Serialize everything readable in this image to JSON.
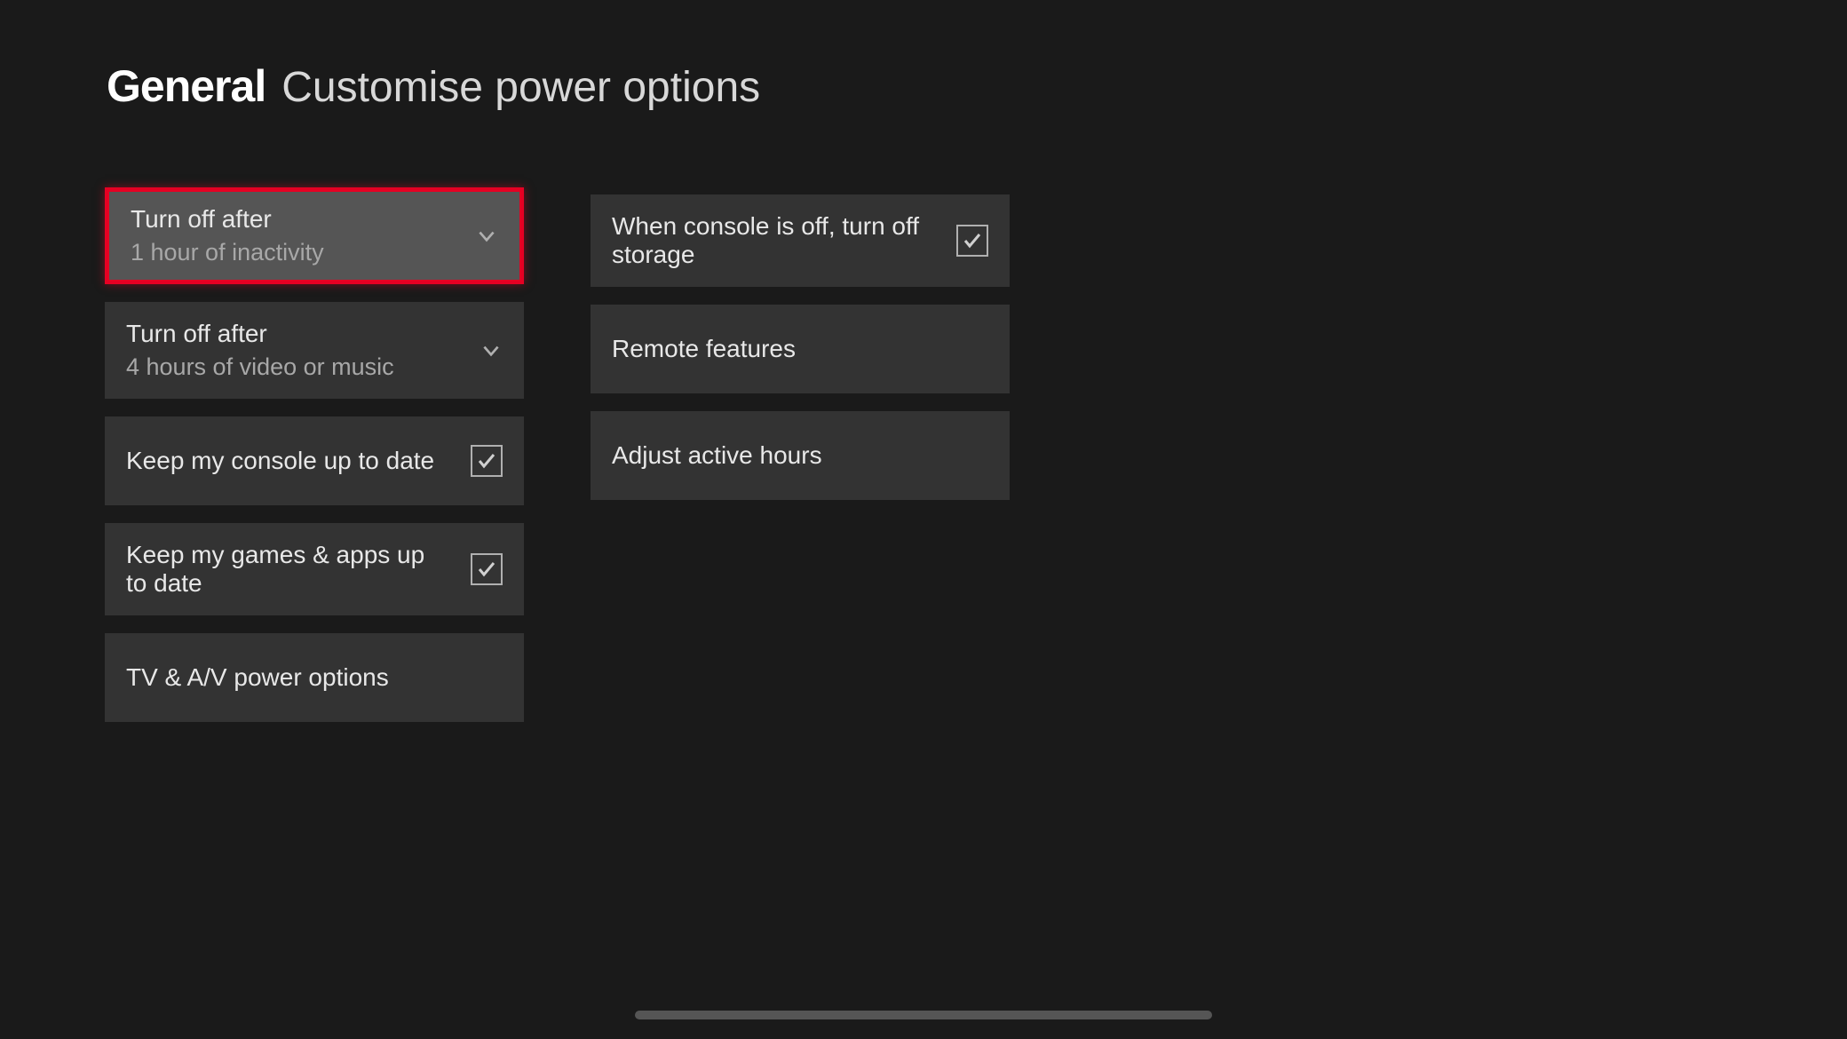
{
  "header": {
    "category": "General",
    "title": "Customise power options"
  },
  "left_column": {
    "turn_off_inactivity": {
      "label": "Turn off after",
      "value": "1 hour of inactivity"
    },
    "turn_off_media": {
      "label": "Turn off after",
      "value": "4 hours of video or music"
    },
    "keep_console_updated": {
      "label": "Keep my console up to date",
      "checked": true
    },
    "keep_games_updated": {
      "label": "Keep my games & apps up to date",
      "checked": true
    },
    "tv_av_power": {
      "label": "TV & A/V power options"
    }
  },
  "right_column": {
    "turn_off_storage": {
      "label": "When console is off, turn off storage",
      "checked": true
    },
    "remote_features": {
      "label": "Remote features"
    },
    "active_hours": {
      "label": "Adjust active hours"
    }
  }
}
